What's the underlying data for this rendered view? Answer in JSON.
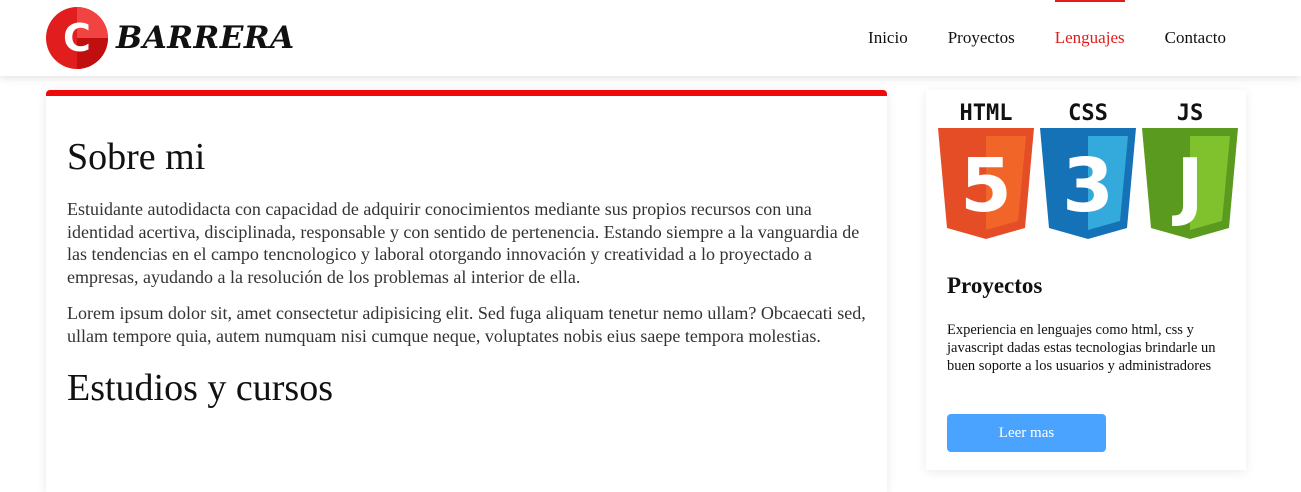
{
  "brand": {
    "logo_letter": "C",
    "name": "BARRERA",
    "accent_color": "#ee0a0a"
  },
  "nav": {
    "items": [
      {
        "label": "Inicio",
        "active": false
      },
      {
        "label": "Proyectos",
        "active": false
      },
      {
        "label": "Lenguajes",
        "active": true
      },
      {
        "label": "Contacto",
        "active": false
      }
    ]
  },
  "main": {
    "section1_title": "Sobre mi",
    "paragraph1": "Estuidante autodidacta con capacidad de adquirir conocimientos mediante sus propios recursos con una identidad acertiva, disciplinada, responsable y con sentido de pertenencia. Estando siempre a la vanguardia de las tendencias en el campo tencnologico y laboral otorgando innovación y creatividad a lo proyectado a empresas, ayudando a la resolución de los problemas al interior de ella.",
    "paragraph2": "Lorem ipsum dolor sit, amet consectetur adipisicing elit. Sed fuga aliquam tenetur nemo ullam? Obcaecati sed, ullam tempore quia, autem numquam nisi cumque neque, voluptates nobis eius saepe tempora molestias.",
    "section2_title": "Estudios y cursos"
  },
  "side": {
    "badges": [
      {
        "label": "HTML",
        "digit": "5",
        "color": "#e44d26",
        "icon": "html5-icon"
      },
      {
        "label": "CSS",
        "digit": "3",
        "color": "#1572b6",
        "icon": "css3-icon"
      },
      {
        "label": "JS",
        "digit": "J",
        "color": "#6fb128",
        "icon": "js-icon"
      }
    ],
    "title": "Proyectos",
    "text": "Experiencia en lenguajes como html, css y javascript dadas estas tecnologias brindarle un buen soporte a los usuarios y administradores",
    "button_label": "Leer mas",
    "button_color": "#4aa3ff"
  }
}
